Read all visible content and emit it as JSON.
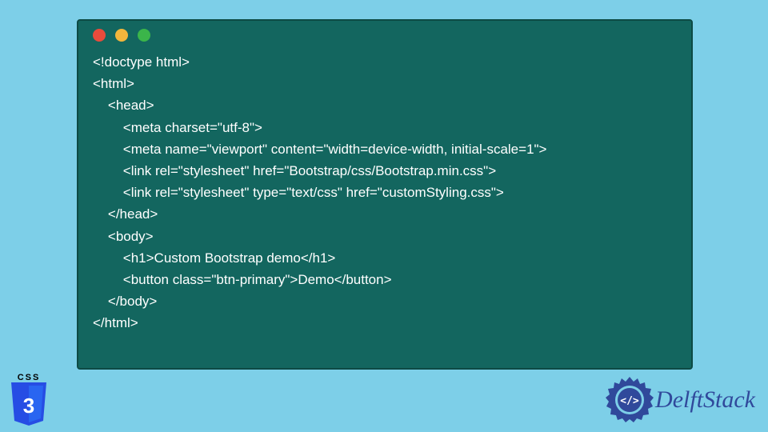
{
  "code": {
    "lines": [
      "<!doctype html>",
      "<html>",
      "    <head>",
      "        <meta charset=\"utf-8\">",
      "        <meta name=\"viewport\" content=\"width=device-width, initial-scale=1\">",
      "        <link rel=\"stylesheet\" href=\"Bootstrap/css/Bootstrap.min.css\">",
      "        <link rel=\"stylesheet\" type=\"text/css\" href=\"customStyling.css\">",
      "    </head>",
      "    <body>",
      "        <h1>Custom Bootstrap demo</h1>",
      "        <button class=\"btn-primary\">Demo</button>",
      "    </body>",
      "</html>"
    ]
  },
  "logos": {
    "css3_label": "CSS",
    "css3_digit": "3",
    "delft_text": "DelftStack",
    "delft_gear_inner": "</>"
  },
  "colors": {
    "page_bg": "#7dcfe8",
    "window_bg": "#13665f",
    "css3_blue": "#264de4",
    "css3_light": "#2965f1",
    "delft_blue": "#30499b"
  }
}
